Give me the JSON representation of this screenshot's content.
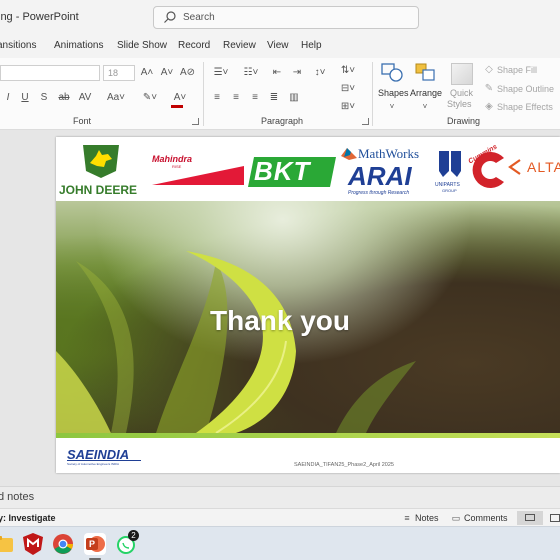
{
  "window": {
    "title": "ing - PowerPoint",
    "search_placeholder": "Search"
  },
  "tabs": [
    "ansitions",
    "Animations",
    "Slide Show",
    "Record",
    "Review",
    "View",
    "Help"
  ],
  "ribbon": {
    "font_size": "18",
    "font_group": "Font",
    "paragraph_group": "Paragraph",
    "drawing_group": "Drawing",
    "shapes_label": "Shapes",
    "arrange_label": "Arrange",
    "quick_styles_label": "Quick",
    "quick_styles_label2": "Styles",
    "shape_fill": "Shape Fill",
    "shape_outline": "Shape Outline",
    "shape_effects": "Shape Effects"
  },
  "slide": {
    "logos": {
      "john_deere": "JOHN DEERE",
      "mahindra": "Mahindra",
      "mahindra_sub": "RISE",
      "bkt": "BKT",
      "mathworks": "MathWorks",
      "arai": "ARAI",
      "arai_sub": "Progress through Research",
      "uniparts": "UNIPARTS",
      "uniparts_sub": "GROUP",
      "cummins": "Cummins",
      "alta": "ALTA"
    },
    "title": "Thank you",
    "saeindia": "SAEINDIA",
    "saeindia_sub": "Society of Automotive Engineers INDIA",
    "footer": "SAEINDIA_TIFAN25_Phase2_April 2025"
  },
  "notes_label": "d notes",
  "status": {
    "left": "y: Investigate",
    "notes": "Notes",
    "comments": "Comments"
  },
  "taskbar": {
    "whatsapp_badge": "2"
  },
  "colors": {
    "accent": "#c43e1c",
    "john_deere_green": "#367c2b",
    "bkt_green": "#2aa836",
    "arai_blue": "#1f3f95",
    "cummins_red": "#d2232a"
  }
}
